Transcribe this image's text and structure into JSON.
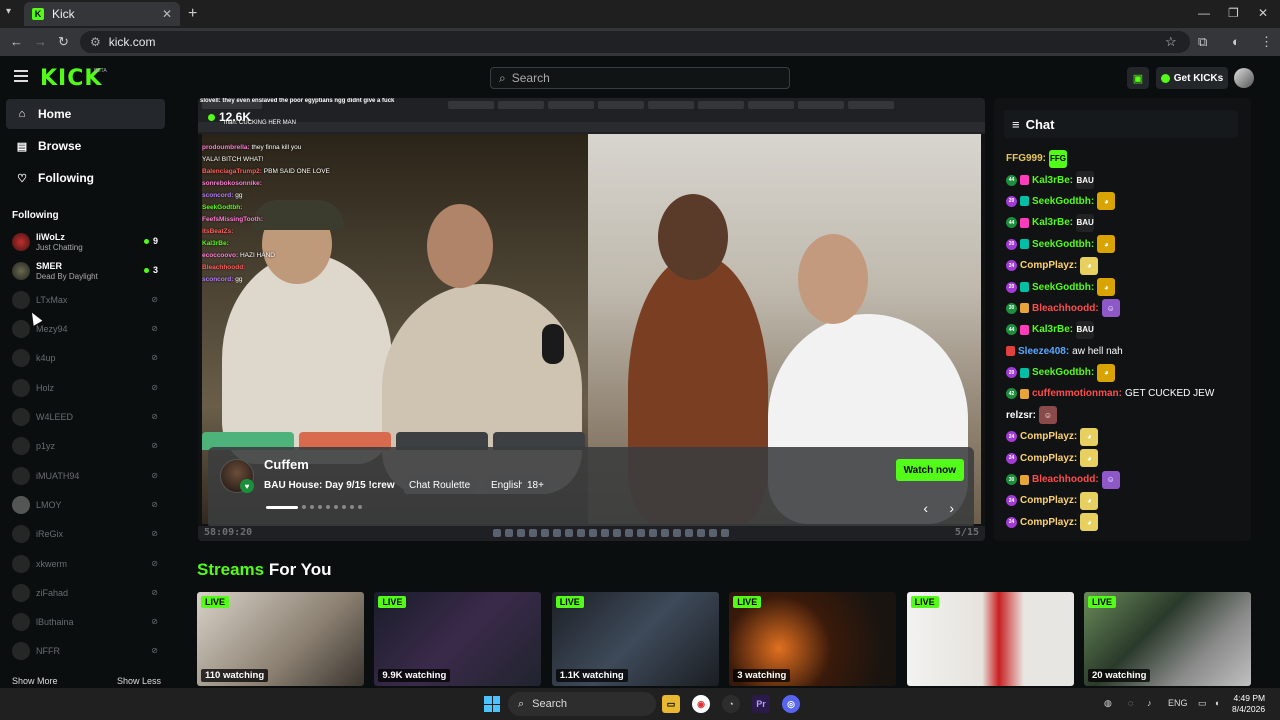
{
  "browser": {
    "tab_title": "Kick",
    "tab_favicon": "K",
    "url": "kick.com",
    "new_tab": "+",
    "close": "✕"
  },
  "header": {
    "logo": "KICK",
    "beta": "BETA",
    "search_placeholder": "Search",
    "get_kicks": "Get KICKs"
  },
  "sidebar": {
    "nav": [
      {
        "label": "Home",
        "icon": "home-icon"
      },
      {
        "label": "Browse",
        "icon": "browse-icon"
      },
      {
        "label": "Following",
        "icon": "heart-icon"
      }
    ],
    "following_title": "Following",
    "following": [
      {
        "name": "liWoLz",
        "category": "Just Chatting",
        "viewers": "9",
        "live": true
      },
      {
        "name": "SMER",
        "category": "Dead By Daylight",
        "viewers": "3",
        "live": true
      },
      {
        "name": "LTxMax",
        "live": false
      },
      {
        "name": "Mezy94",
        "live": false
      },
      {
        "name": "k4up",
        "live": false
      },
      {
        "name": "Holz",
        "live": false
      },
      {
        "name": "W4LEED",
        "live": false
      },
      {
        "name": "p1yz",
        "live": false
      },
      {
        "name": "iMUATH94",
        "live": false
      },
      {
        "name": "LMOY",
        "live": false
      },
      {
        "name": "iReGix",
        "live": false
      },
      {
        "name": "xkwerm",
        "live": false
      },
      {
        "name": "ziFahad",
        "live": false
      },
      {
        "name": "lButhaina",
        "live": false
      },
      {
        "name": "NFFR",
        "live": false
      }
    ],
    "show_more": "Show More",
    "show_less": "Show Less"
  },
  "player": {
    "live_count": "12.6K",
    "overlay_top": "slovell: they even enslaved the poor egyptians ngg didnt give a fuck",
    "overlay_top2": "man: CUCKING HER MAN",
    "overlay_chat": [
      {
        "user": "prodoumbrella:",
        "text": "they finna kill you",
        "cls": "u2"
      },
      {
        "user": "",
        "text": "YALA! BITCH WHAT!",
        "cls": "u"
      },
      {
        "user": "BalenciagaTrump2:",
        "text": "PBM SAID ONE LOVE",
        "cls": "u3"
      },
      {
        "user": "sonrebokosonnike:",
        "text": "",
        "cls": "u2"
      },
      {
        "user": "sconcord:",
        "text": "gg",
        "cls": "u4"
      },
      {
        "user": "SeekGodtbh:",
        "text": "",
        "cls": "u"
      },
      {
        "user": "FeefsMissingTooth:",
        "text": "",
        "cls": "u2"
      },
      {
        "user": "itsBeatZs:",
        "text": "",
        "cls": "u3"
      },
      {
        "user": "Kal3rBe:",
        "text": "",
        "cls": "u"
      },
      {
        "user": "ecoccoovo:",
        "text": "HAZI HAND",
        "cls": "u2"
      },
      {
        "user": "Bleachhoodd:",
        "text": "",
        "cls": "u3"
      },
      {
        "user": "sconcord:",
        "text": "gg",
        "cls": "u4"
      }
    ],
    "timestamp_left": "58:09:20",
    "timestamp_right": "5/15"
  },
  "featured": {
    "channel": "Cuffem",
    "title": "BAU House: Day 9/15 !crew",
    "tags": [
      "Chat Roulette",
      "English",
      "18+"
    ],
    "watch_now": "Watch now",
    "prev": "‹",
    "next": "›"
  },
  "chat": {
    "title": "Chat",
    "messages": [
      {
        "badge": "",
        "bcolor": "",
        "sub": "",
        "user": "FFG999:",
        "ucolor": "#e8c85a",
        "emote": "FFG",
        "ecolor": "#53fc18",
        "text": ""
      },
      {
        "badge": "44",
        "bcolor": "#1c8f3c",
        "sub": "#ff3dbb",
        "user": "Kal3rBe:",
        "ucolor": "#53fc18",
        "emote": "BAU",
        "ecolor": "#222",
        "text": ""
      },
      {
        "badge": "20",
        "bcolor": "#a23bd6",
        "sub": "#00bfa5",
        "user": "SeekGodtbh:",
        "ucolor": "#53fc18",
        "emote": "◕",
        "ecolor": "#d9a400",
        "text": ""
      },
      {
        "badge": "44",
        "bcolor": "#1c8f3c",
        "sub": "#ff3dbb",
        "user": "Kal3rBe:",
        "ucolor": "#53fc18",
        "emote": "BAU",
        "ecolor": "#222",
        "text": ""
      },
      {
        "badge": "20",
        "bcolor": "#a23bd6",
        "sub": "#00bfa5",
        "user": "SeekGodtbh:",
        "ucolor": "#53fc18",
        "emote": "◕",
        "ecolor": "#d9a400",
        "text": ""
      },
      {
        "badge": "24",
        "bcolor": "#a23bd6",
        "sub": "",
        "user": "CompPlayz:",
        "ucolor": "#ffd36b",
        "emote": "◕",
        "ecolor": "#e8d060",
        "text": ""
      },
      {
        "badge": "20",
        "bcolor": "#a23bd6",
        "sub": "#00bfa5",
        "user": "SeekGodtbh:",
        "ucolor": "#53fc18",
        "emote": "◕",
        "ecolor": "#d9a400",
        "text": ""
      },
      {
        "badge": "30",
        "bcolor": "#1c8f3c",
        "sub": "#e8a33a",
        "user": "Bleachhoodd:",
        "ucolor": "#ff4d4d",
        "emote": "☺",
        "ecolor": "#8e58c9",
        "text": ""
      },
      {
        "badge": "44",
        "bcolor": "#1c8f3c",
        "sub": "#ff3dbb",
        "user": "Kal3rBe:",
        "ucolor": "#53fc18",
        "emote": "BAU",
        "ecolor": "#222",
        "text": ""
      },
      {
        "badge": "",
        "bcolor": "",
        "sub": "#e04040",
        "user": "Sleeze408:",
        "ucolor": "#5aa8ff",
        "emote": "",
        "ecolor": "",
        "text": "aw hell nah"
      },
      {
        "badge": "20",
        "bcolor": "#a23bd6",
        "sub": "#00bfa5",
        "user": "SeekGodtbh:",
        "ucolor": "#53fc18",
        "emote": "◕",
        "ecolor": "#d9a400",
        "text": ""
      },
      {
        "badge": "42",
        "bcolor": "#1c8f3c",
        "sub": "#e8a33a",
        "user": "cuffemmotionman:",
        "ucolor": "#ff4d4d",
        "emote": "",
        "ecolor": "",
        "text": "GET CUCKED JEW"
      },
      {
        "badge": "",
        "bcolor": "",
        "sub": "",
        "user": "relzsr:",
        "ucolor": "#ffffff",
        "emote": "☺",
        "ecolor": "#8a4a4a",
        "text": ""
      },
      {
        "badge": "24",
        "bcolor": "#a23bd6",
        "sub": "",
        "user": "CompPlayz:",
        "ucolor": "#ffd36b",
        "emote": "◕",
        "ecolor": "#e8d060",
        "text": ""
      },
      {
        "badge": "24",
        "bcolor": "#a23bd6",
        "sub": "",
        "user": "CompPlayz:",
        "ucolor": "#ffd36b",
        "emote": "◕",
        "ecolor": "#e8d060",
        "text": ""
      },
      {
        "badge": "30",
        "bcolor": "#1c8f3c",
        "sub": "#e8a33a",
        "user": "Bleachhoodd:",
        "ucolor": "#ff4d4d",
        "emote": "☺",
        "ecolor": "#8e58c9",
        "text": ""
      },
      {
        "badge": "24",
        "bcolor": "#a23bd6",
        "sub": "",
        "user": "CompPlayz:",
        "ucolor": "#ffd36b",
        "emote": "◕",
        "ecolor": "#e8d060",
        "text": ""
      },
      {
        "badge": "24",
        "bcolor": "#a23bd6",
        "sub": "",
        "user": "CompPlayz:",
        "ucolor": "#ffd36b",
        "emote": "◕",
        "ecolor": "#e8d060",
        "text": ""
      }
    ]
  },
  "streams": {
    "title_green": "Streams",
    "title_rest": "For You",
    "live_label": "LIVE",
    "cards": [
      {
        "watching": "110 watching",
        "bg": "linear-gradient(135deg,#d8d2c8,#8a7f70 60%,#3b3530)"
      },
      {
        "watching": "9.9K watching",
        "bg": "linear-gradient(135deg,#1a1d2a,#3a2a4a 50%,#20242e)"
      },
      {
        "watching": "1.1K watching",
        "bg": "linear-gradient(135deg,#1d2026,#3e4a5a 50%,#1b1e22)"
      },
      {
        "watching": "3 watching",
        "bg": "radial-gradient(circle at 30% 60%,#e07020,#3a1a0a 40%,#1a1410 80%)"
      },
      {
        "watching": "",
        "bg": "linear-gradient(90deg,#f2f2f0,#e6e3de 45%,#c82020 55%,#e8e6e2 70%)"
      },
      {
        "watching": "20 watching",
        "bg": "linear-gradient(135deg,#6a8a5a,#2a3a2a 40%,#8a8a8a 70%,#c0c0c0)"
      }
    ]
  },
  "taskbar": {
    "search": "Search",
    "lang": "ENG",
    "time": "4:49 PM",
    "date": "8/4/2026"
  },
  "colors": {
    "accent": "#53fc18",
    "background": "#0b0e0f",
    "panel": "#101214"
  }
}
